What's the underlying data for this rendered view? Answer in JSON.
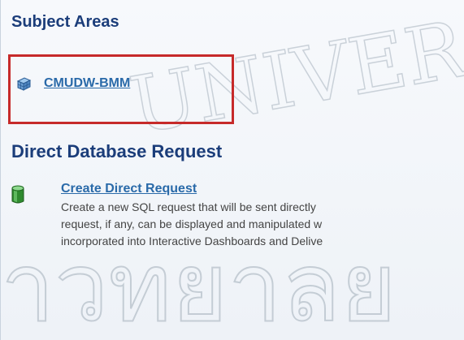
{
  "subject_areas": {
    "title": "Subject Areas",
    "items": [
      {
        "label": "CMUDW-BMM"
      }
    ]
  },
  "direct_database_request": {
    "title": "Direct Database Request",
    "link_label": "Create Direct Request",
    "description_lines": [
      "Create a new SQL request that will be sent directly",
      "request, if any, can be displayed and manipulated w",
      "incorporated into Interactive Dashboards and Delive"
    ]
  },
  "watermark": {
    "top_text": "UNIVERS",
    "bottom_text": "าวทยาลย"
  },
  "colors": {
    "title": "#1b3d7a",
    "link": "#2a6aa9",
    "highlight_border": "#c62a2a",
    "body_text": "#444444"
  },
  "icons": {
    "subject_area_item": "cube-icon",
    "direct_request": "database-icon"
  }
}
